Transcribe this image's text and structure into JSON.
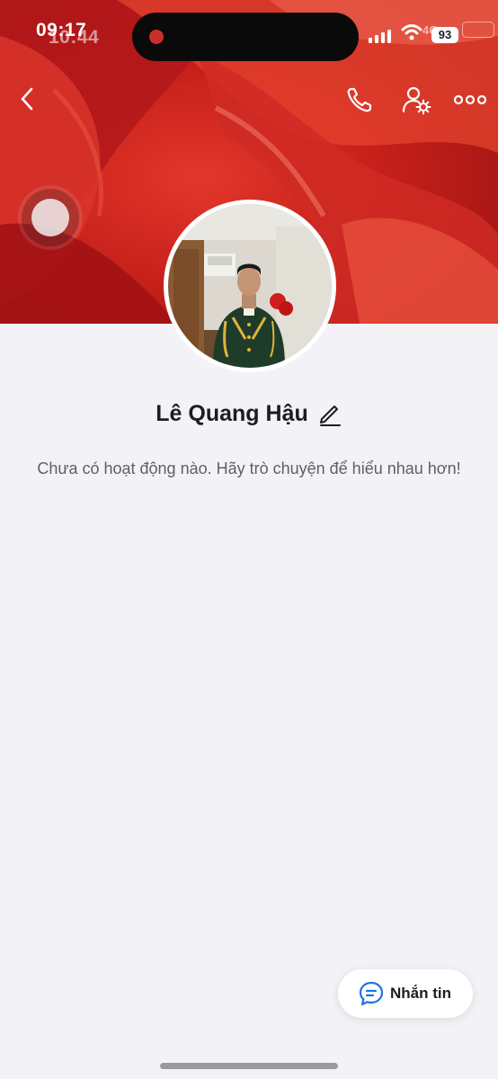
{
  "status_bar": {
    "time": "09:17",
    "time_ghost": "10:44",
    "network": "4G",
    "battery": "93"
  },
  "header": {
    "back_icon": "chevron-left-icon",
    "call_icon": "phone-icon",
    "settings_icon": "user-settings-icon",
    "more_icon": "more-dots-icon"
  },
  "profile": {
    "name": "Lê Quang Hậu",
    "empty_message": "Chưa có hoạt động nào. Hãy trò chuyện để hiểu nhau hơn!"
  },
  "actions": {
    "message_label": "Nhắn tin",
    "message_icon": "chat-bubble-icon"
  },
  "colors": {
    "cover": "#c51f1a",
    "background": "#f3f3f7",
    "accent": "#1a73e8"
  }
}
